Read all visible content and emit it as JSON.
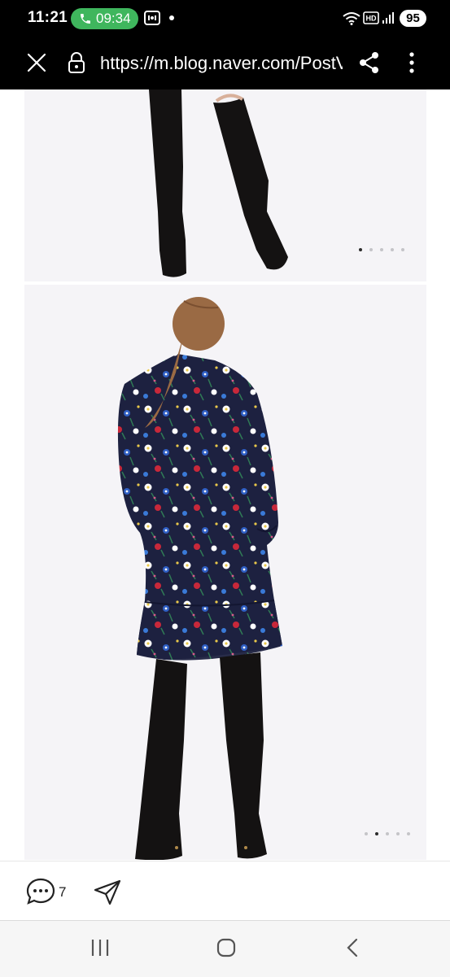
{
  "status_bar": {
    "time": "11:21",
    "call_timer": "09:34",
    "battery": "95",
    "icons": [
      "phone-icon",
      "screen-record-icon",
      "wifi-icon",
      "hd-icon",
      "signal-icon"
    ]
  },
  "browser": {
    "url": "https://m.blog.naver.com/PostView.naver",
    "icons": [
      "close-icon",
      "lock-icon",
      "share-icon",
      "more-vert-icon"
    ]
  },
  "content": {
    "photos": [
      {
        "subject": "boots-lower-legs",
        "carousel_count": 5,
        "active_index": 0
      },
      {
        "subject": "floral-dress-back-view",
        "carousel_count": 5,
        "active_index": 1
      }
    ],
    "colors": {
      "dress": "#1d2140",
      "boots": "#141212",
      "hair": "#9a6a44",
      "background": "#f5f4f7"
    }
  },
  "action_bar": {
    "comment_count": "7",
    "icons": [
      "comment-icon",
      "send-icon"
    ]
  },
  "nav_bar": {
    "icons": [
      "recent-apps-icon",
      "home-icon",
      "back-icon"
    ]
  }
}
